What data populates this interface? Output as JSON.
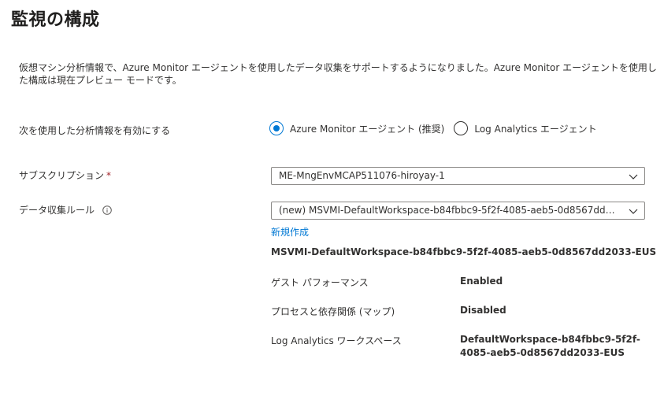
{
  "page": {
    "title": "監視の構成",
    "info_text": "仮想マシン分析情報で、Azure Monitor エージェントを使用したデータ収集をサポートするようになりました。Azure Monitor エージェントを使用した構成は現在プレビュー モードです。"
  },
  "insights": {
    "label": "次を使用した分析情報を有効にする",
    "options": [
      {
        "label": "Azure Monitor エージェント (推奨)",
        "selected": true
      },
      {
        "label": "Log Analytics エージェント",
        "selected": false
      }
    ]
  },
  "subscription": {
    "label": "サブスクリプション",
    "required_mark": "*",
    "value": "ME-MngEnvMCAP511076-hiroyay-1"
  },
  "dcr": {
    "label": "データ収集ルール",
    "value": "(new) MSVMI-DefaultWorkspace-b84fbbc9-5f2f-4085-aeb5-0d8567dd203...",
    "create_new_link": "新規作成",
    "rule_name": "MSVMI-DefaultWorkspace-b84fbbc9-5f2f-4085-aeb5-0d8567dd2033-EUS",
    "details": [
      {
        "label": "ゲスト パフォーマンス",
        "value": "Enabled"
      },
      {
        "label": "プロセスと依存関係 (マップ)",
        "value": "Disabled"
      },
      {
        "label": "Log Analytics ワークスペース",
        "value": "DefaultWorkspace-b84fbbc9-5f2f-4085-aeb5-0d8567dd2033-EUS"
      }
    ]
  },
  "colors": {
    "accent": "#0078d4",
    "required": "#a4262c",
    "text": "#323130"
  },
  "icons": [
    "info-icon",
    "chevron-down-icon"
  ]
}
